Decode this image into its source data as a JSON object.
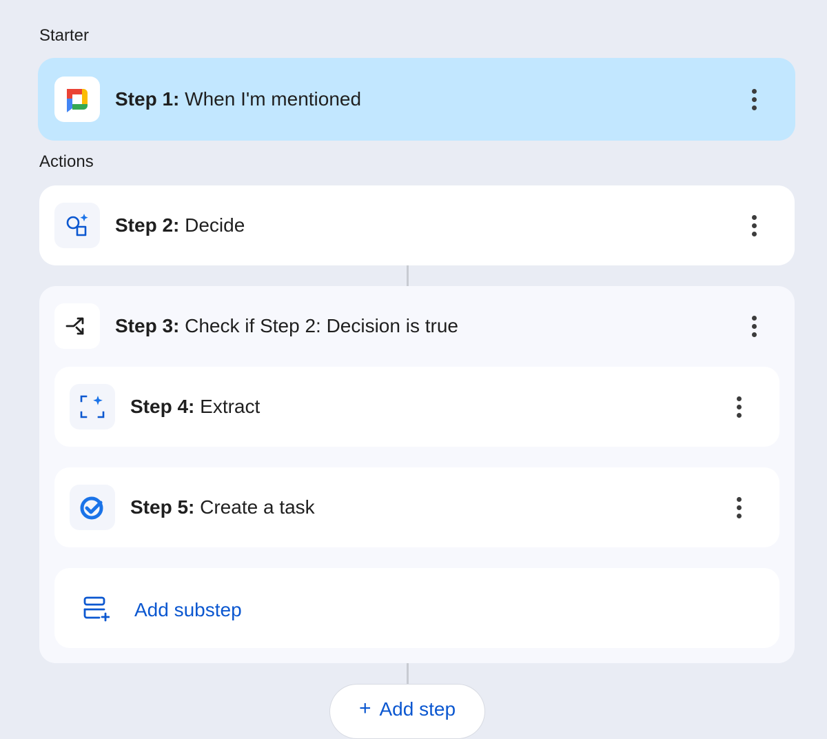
{
  "sections": {
    "starter_label": "Starter",
    "actions_label": "Actions"
  },
  "steps": [
    {
      "prefix": "Step 1:",
      "title": "When I'm mentioned",
      "icon": "google-chat-icon"
    },
    {
      "prefix": "Step 2:",
      "title": "Decide",
      "icon": "decide-sparkle-icon"
    },
    {
      "prefix": "Step 3:",
      "title": "Check if Step 2: Decision is true",
      "icon": "branch-icon"
    },
    {
      "prefix": "Step 4:",
      "title": "Extract",
      "icon": "extract-sparkle-icon"
    },
    {
      "prefix": "Step 5:",
      "title": "Create a task",
      "icon": "task-check-icon"
    }
  ],
  "add_substep_label": "Add substep",
  "add_step_label": "Add step",
  "colors": {
    "background": "#e9ecf4",
    "selected": "#c2e7ff",
    "accent": "#0b57d0"
  }
}
